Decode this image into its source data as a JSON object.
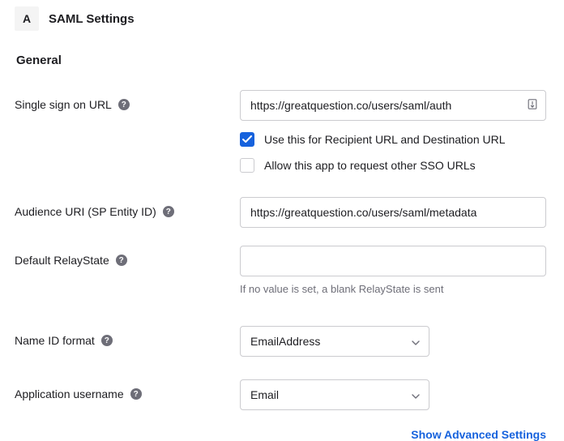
{
  "header": {
    "badge": "A",
    "title": "SAML Settings"
  },
  "general_heading": "General",
  "sso_url": {
    "label": "Single sign on URL",
    "value": "https://greatquestion.co/users/saml/auth",
    "recipient_checkbox_label": "Use this for Recipient URL and Destination URL",
    "allow_other_checkbox_label": "Allow this app to request other SSO URLs"
  },
  "audience": {
    "label": "Audience URI (SP Entity ID)",
    "value": "https://greatquestion.co/users/saml/metadata"
  },
  "relay": {
    "label": "Default RelayState",
    "value": "",
    "helper": "If no value is set, a blank RelayState is sent"
  },
  "nameid": {
    "label": "Name ID format",
    "value": "EmailAddress"
  },
  "app_user": {
    "label": "Application username",
    "value": "Email"
  },
  "advanced_link": "Show Advanced Settings"
}
